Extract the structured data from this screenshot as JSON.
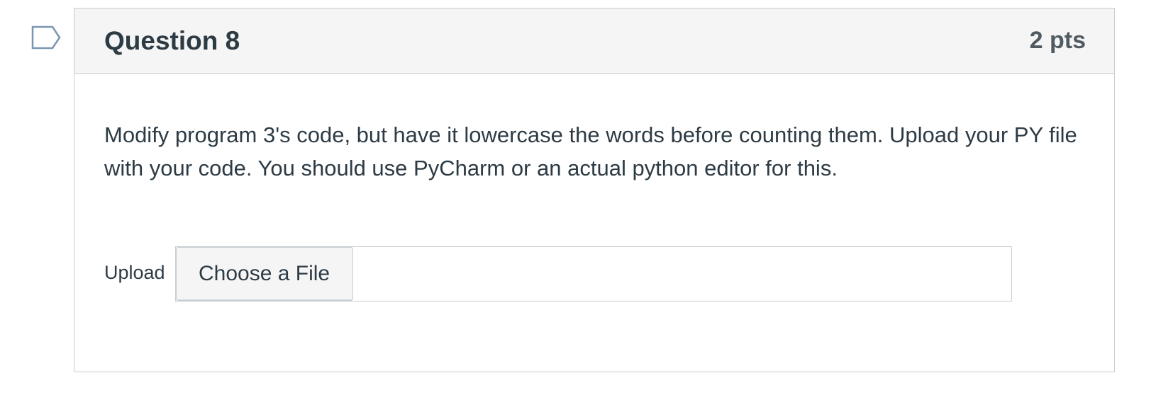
{
  "question": {
    "title": "Question 8",
    "points": "2 pts",
    "text": "Modify program 3's code, but have it lowercase the words before counting them.  Upload your PY file with your code.  You should use PyCharm or an actual python editor for this.",
    "flag_icon": "bookmark-flag-icon"
  },
  "upload": {
    "label": "Upload",
    "button_label": "Choose a File",
    "file_name": ""
  },
  "colors": {
    "header_bg": "#f5f5f5",
    "border": "#c7cdd1",
    "text": "#2d3b45",
    "flag_stroke": "#7a96b3"
  }
}
